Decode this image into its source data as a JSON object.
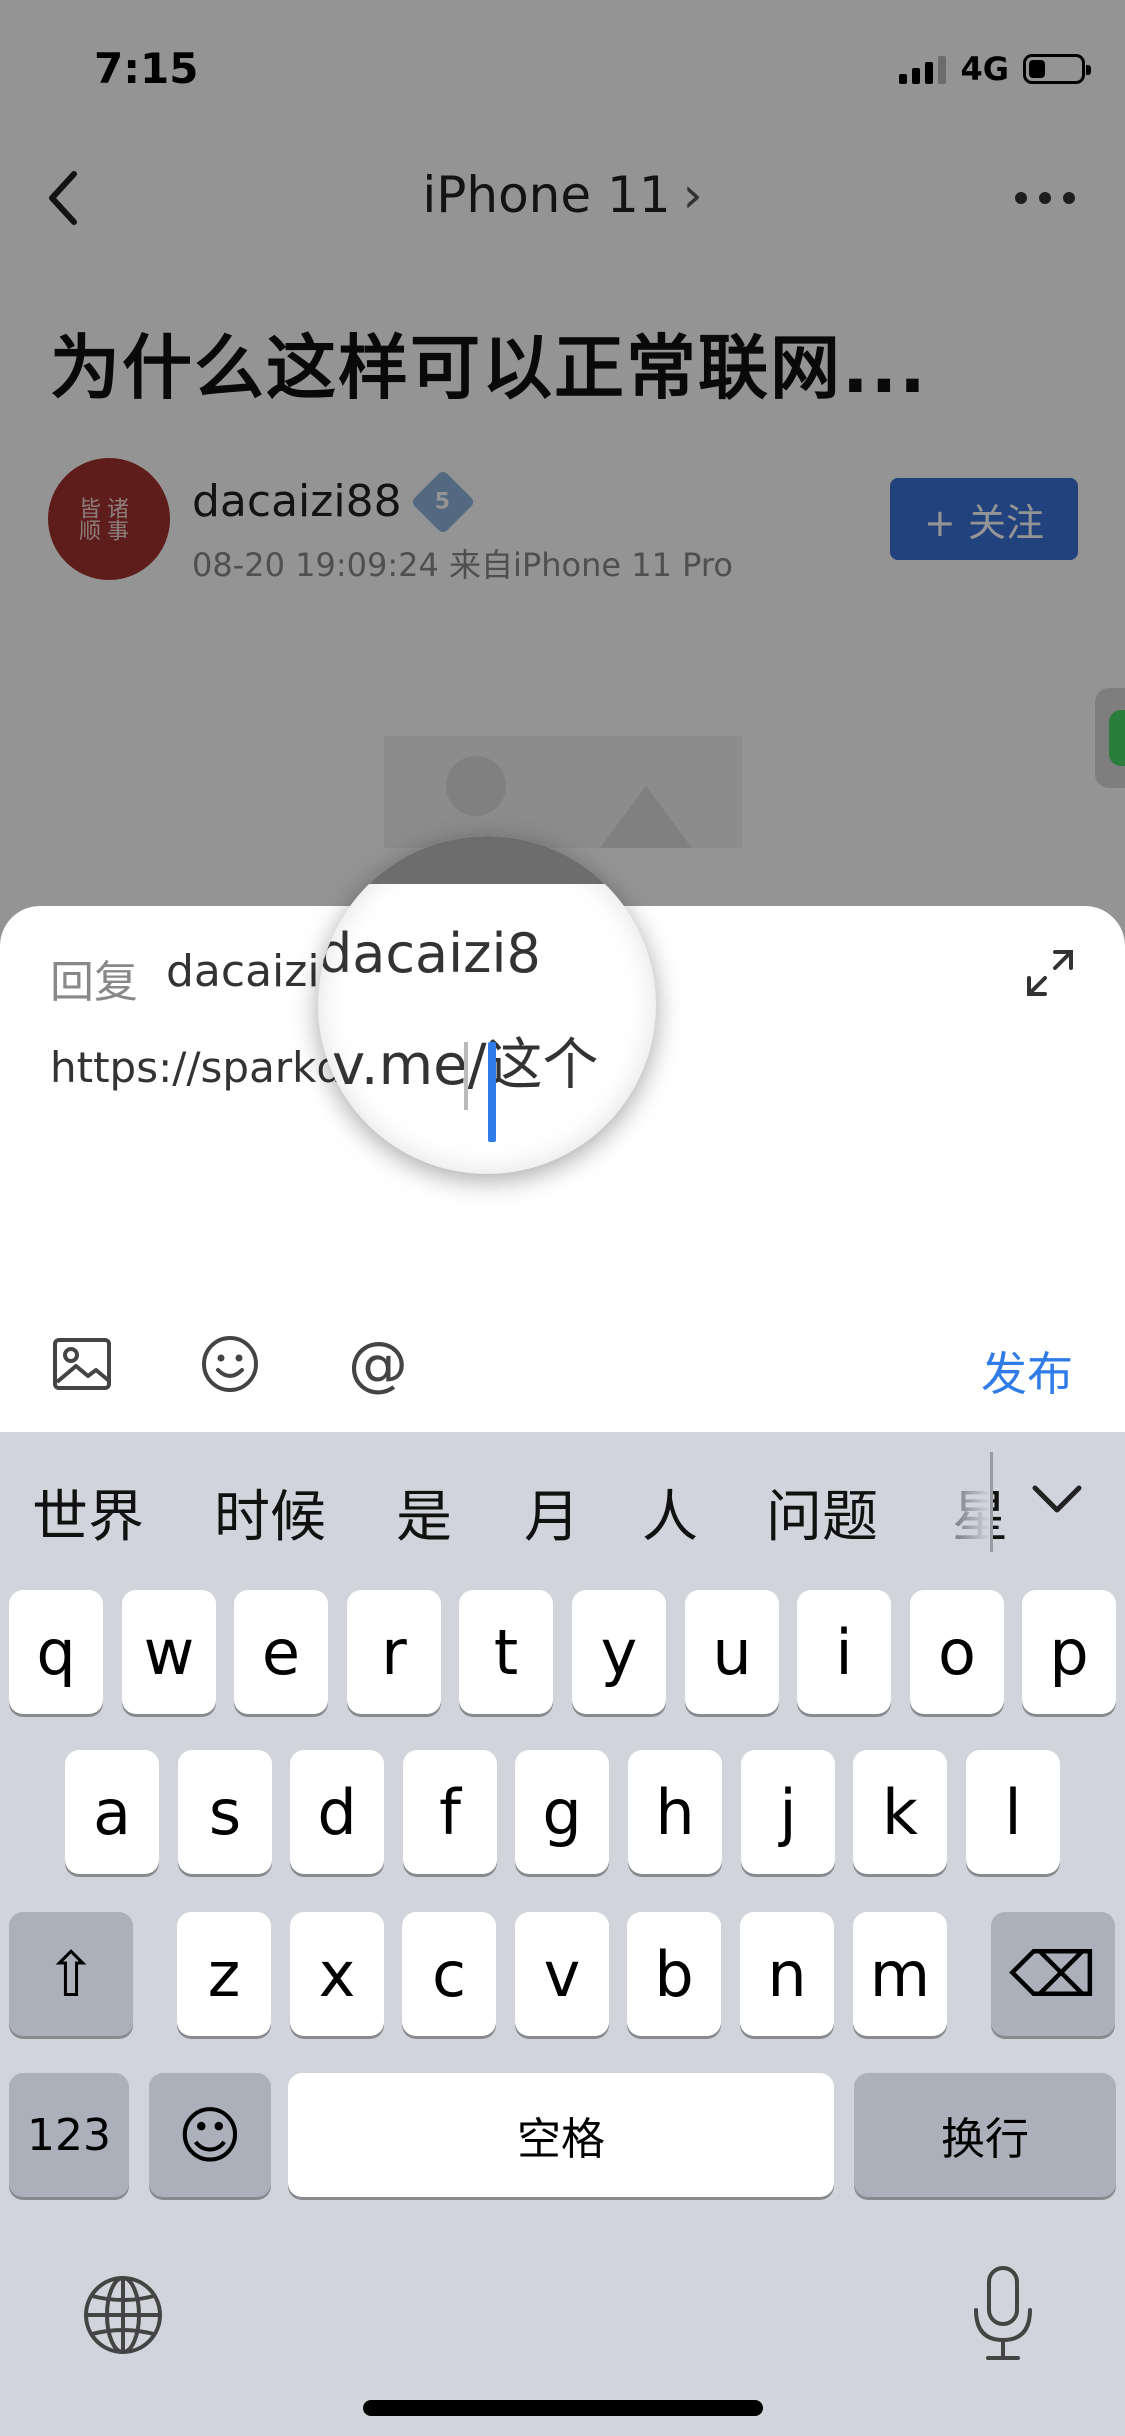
{
  "status_bar": {
    "time": "7:15",
    "network": "4G",
    "signal_bars": 4,
    "signal_active_bars": 3,
    "battery_level": 0.3
  },
  "nav": {
    "title": "iPhone 11",
    "title_chevron": "›"
  },
  "post": {
    "title": "为什么这样可以正常联网...",
    "author": "dacaizi88",
    "author_level": "5",
    "avatar_seal_text": "诸事皆顺",
    "meta": "08-20 19:09:24 来自iPhone 11 Pro",
    "follow_label": "+ 关注"
  },
  "reply": {
    "label": "回复",
    "to_user": "dacaizi88",
    "text": "https://sparkdev.me/这个",
    "publish_label": "发布"
  },
  "magnifier": {
    "name_fragment": "dacaizi8",
    "text_fragment": "v.me/这个"
  },
  "keyboard": {
    "candidates": [
      "世界",
      "时候",
      "是",
      "月",
      "人",
      "问题",
      "星"
    ],
    "row1": [
      "q",
      "w",
      "e",
      "r",
      "t",
      "y",
      "u",
      "i",
      "o",
      "p"
    ],
    "row2": [
      "a",
      "s",
      "d",
      "f",
      "g",
      "h",
      "j",
      "k",
      "l"
    ],
    "row3": [
      "z",
      "x",
      "c",
      "v",
      "b",
      "n",
      "m"
    ],
    "numbers_label": "123",
    "space_label": "空格",
    "return_label": "换行",
    "emoji_glyph": "☺",
    "shift_glyph": "⇧",
    "delete_glyph": "⌫"
  },
  "icons": {
    "back": "chevron-left-icon",
    "more": "more-dots-icon",
    "expand": "expand-icon",
    "image": "image-icon",
    "emoji": "emoji-icon",
    "mention": "at-icon",
    "collapse": "chevron-down-icon",
    "globe": "globe-icon",
    "mic": "microphone-icon"
  },
  "colors": {
    "accent": "#2f7ce8",
    "follow": "#3a72d8",
    "keyboard_bg": "#d1d4da",
    "function_key": "#abb0ba"
  }
}
